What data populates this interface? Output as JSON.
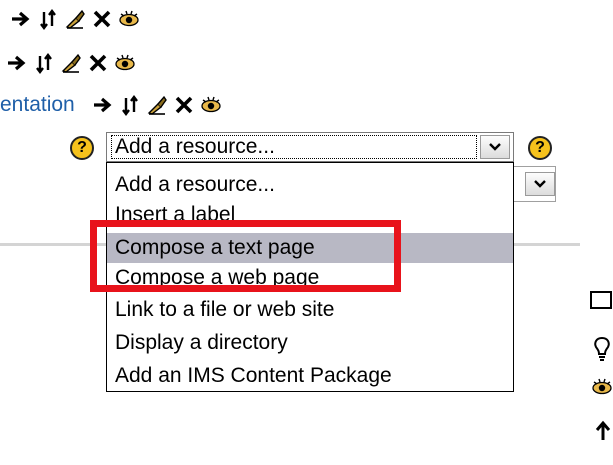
{
  "rows": {
    "row3_link": "entation"
  },
  "icons": {
    "move": "arrow-right-icon",
    "updown": "move-updown-icon",
    "edit": "edit-icon",
    "delete": "delete-icon",
    "visibility": "eye-icon",
    "help": "?"
  },
  "select": {
    "value": "Add a resource..."
  },
  "dropdown": {
    "options": [
      "Add a resource...",
      "Insert a label",
      "Compose a text page",
      "Compose a web page",
      "Link to a file or web site",
      "Display a directory",
      "Add an IMS Content Package"
    ],
    "selected_index": 2
  },
  "colors": {
    "highlight": "#e8131b",
    "selected_option": "#b8b8c4",
    "link": "#1f5fa8",
    "help_bubble": "#f6c21c"
  }
}
